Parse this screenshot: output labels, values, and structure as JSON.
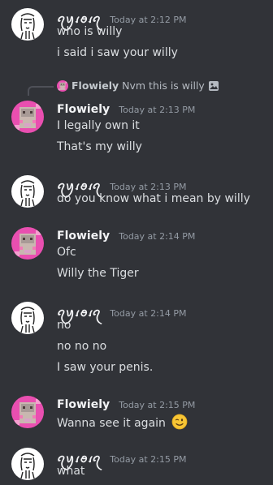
{
  "users": {
    "kaiyora": {
      "name": "ꪖꪗꪹꪮꪹꪖ",
      "avatar_icon": "sketch-avatar-icon"
    },
    "flowiely": {
      "name": "Flowiely",
      "avatar_icon": "pink-pixel-avatar-icon"
    }
  },
  "messages": [
    {
      "timestamp": "Today at 2:12 PM",
      "lines": [
        "who is willy",
        "i said i saw your willy"
      ]
    },
    {
      "reply": {
        "name": "Flowiely",
        "text": "Nvm this is willy",
        "attachment_icon": "image-icon"
      },
      "timestamp": "Today at 2:13 PM",
      "lines": [
        "I legally own it",
        "That's my willy"
      ]
    },
    {
      "timestamp": "Today at 2:13 PM",
      "lines": [
        "do you know what i mean by willy"
      ]
    },
    {
      "timestamp": "Today at 2:14 PM",
      "lines": [
        "Ofc",
        "Willy the Tiger"
      ]
    },
    {
      "timestamp": "Today at 2:14 PM",
      "lines": [
        "no",
        "no no no",
        "I saw your penis."
      ]
    },
    {
      "timestamp": "Today at 2:15 PM",
      "lines": [
        "Wanna see it again"
      ],
      "emoji": "winking-face-emoji"
    },
    {
      "timestamp": "Today at 2:15 PM",
      "lines": [
        "what"
      ]
    }
  ],
  "colors": {
    "background": "#313338",
    "username": "#f2f3f5",
    "timestamp": "#949ba4",
    "text": "#dbdee1",
    "flowiely_avatar": "#e94fb0"
  }
}
